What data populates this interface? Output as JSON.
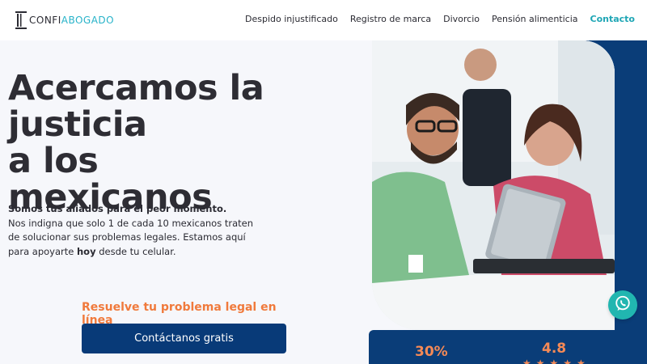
{
  "logo": {
    "part1": "CONFI",
    "part2": "ABOGADO"
  },
  "nav": {
    "items": [
      "Despido injustificado",
      "Registro de marca",
      "Divorcio",
      "Pensión alimenticia"
    ],
    "contact": "Contacto"
  },
  "hero": {
    "title_lines": [
      "Acercamos la",
      "justicia",
      "a los mexicanos"
    ],
    "lead_strong": "Somos tus aliados para el peor momento.",
    "lead_text": "Nos indigna que solo 1 de cada 10 mexicanos traten de solucionar sus problemas legales. Estamos aquí para apoyarte",
    "lead_bold": "hoy",
    "lead_tail": "desde tu celular."
  },
  "cta": {
    "label": "Resuelve tu problema legal en línea",
    "button": "Contáctanos gratis"
  },
  "stats": {
    "value1": "30%",
    "rating": "4.8",
    "stars": "★★★★★"
  },
  "icons": {
    "logo": "columns-logo-icon",
    "chat": "whatsapp-icon"
  },
  "colors": {
    "accent": "#1fa6b5",
    "brand_blue": "#083a78",
    "orange": "#f07a3c"
  }
}
